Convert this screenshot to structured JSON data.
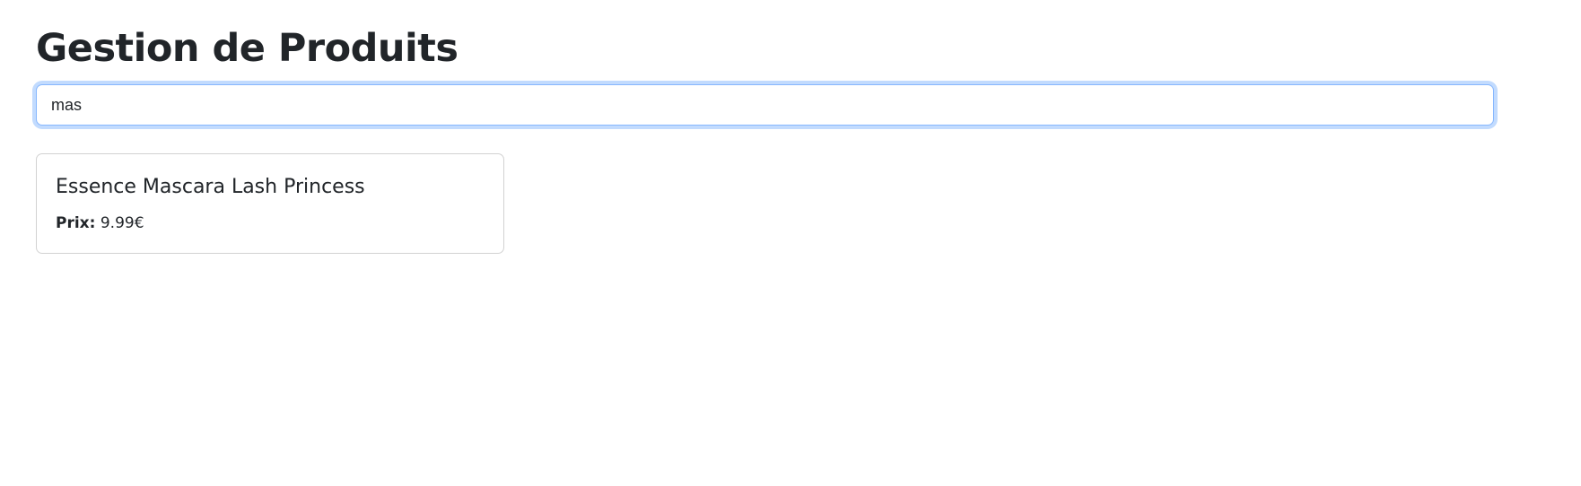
{
  "page": {
    "title": "Gestion de Produits"
  },
  "search": {
    "value": "mas",
    "focus_ring_color": "#86b7fe"
  },
  "products": [
    {
      "name": "Essence Mascara Lash Princess",
      "price_label": "Prix:",
      "price_value": "9.99€"
    }
  ]
}
